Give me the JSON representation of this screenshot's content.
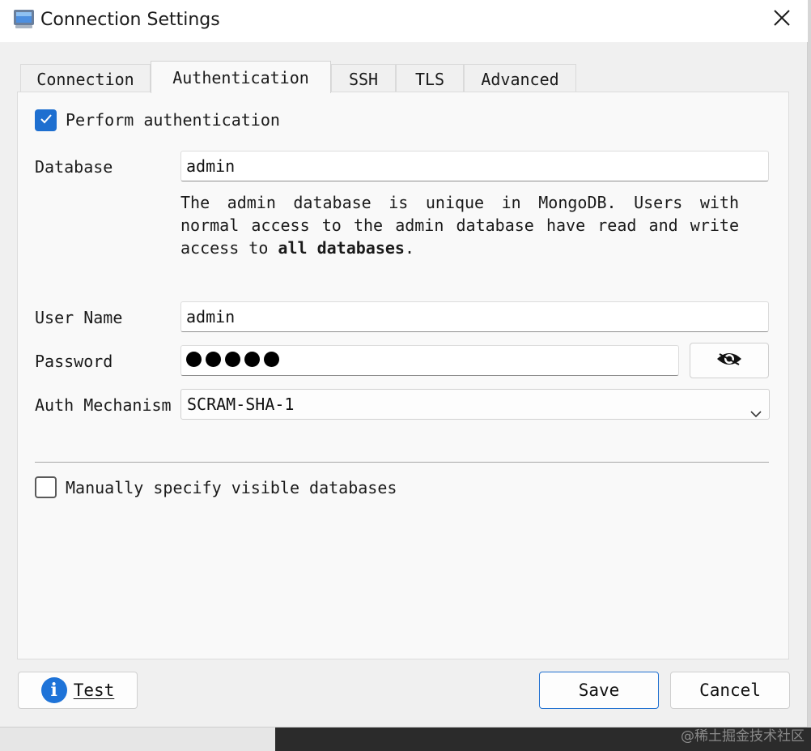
{
  "window": {
    "title": "Connection Settings"
  },
  "tabs": [
    {
      "label": "Connection",
      "active": false
    },
    {
      "label": "Authentication",
      "active": true
    },
    {
      "label": "SSH",
      "active": false
    },
    {
      "label": "TLS",
      "active": false
    },
    {
      "label": "Advanced",
      "active": false
    }
  ],
  "auth": {
    "perform_label": "Perform authentication",
    "perform_checked": true,
    "database_label": "Database",
    "database_value": "admin",
    "desc_part1": "The admin database is unique in MongoDB. Users with normal access to the admin database have read and write access to ",
    "desc_bold": "all databases",
    "desc_end": ".",
    "username_label": "User Name",
    "username_value": "admin",
    "password_label": "Password",
    "password_mask_count": 5,
    "mechanism_label": "Auth Mechanism",
    "mechanism_value": "SCRAM-SHA-1",
    "manual_label": "Manually specify visible databases",
    "manual_checked": false
  },
  "buttons": {
    "test": "Test",
    "save": "Save",
    "cancel": "Cancel"
  },
  "watermark": "@稀土掘金技术社区",
  "colors": {
    "accent": "#1e6fd0",
    "info": "#1e73d8"
  }
}
